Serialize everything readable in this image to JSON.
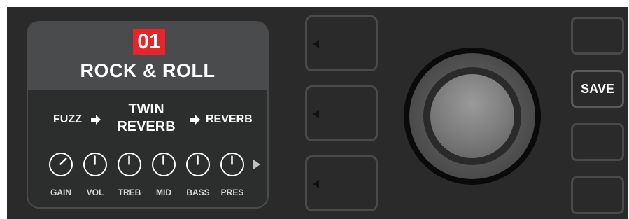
{
  "preset": {
    "number": "01",
    "name": "ROCK & ROLL"
  },
  "signal_chain": {
    "effect_pre": "FUZZ",
    "amp_line1": "TWIN",
    "amp_line2": "REVERB",
    "effect_post": "REVERB"
  },
  "knobs": [
    {
      "label": "GAIN",
      "angle_deg": 45
    },
    {
      "label": "VOL",
      "angle_deg": 0
    },
    {
      "label": "TREB",
      "angle_deg": 0
    },
    {
      "label": "MID",
      "angle_deg": 0
    },
    {
      "label": "BASS",
      "angle_deg": 0
    },
    {
      "label": "PRES",
      "angle_deg": 0
    }
  ],
  "right_buttons": {
    "save_label": "SAVE"
  },
  "colors": {
    "panel": "#2b2a2a",
    "preset_badge": "#e8232a",
    "text": "#ffffff"
  },
  "icons": {
    "chain_arrow": "right-arrow-icon",
    "more_knobs": "play-right-icon",
    "soft_button": "left-triangle-icon"
  }
}
